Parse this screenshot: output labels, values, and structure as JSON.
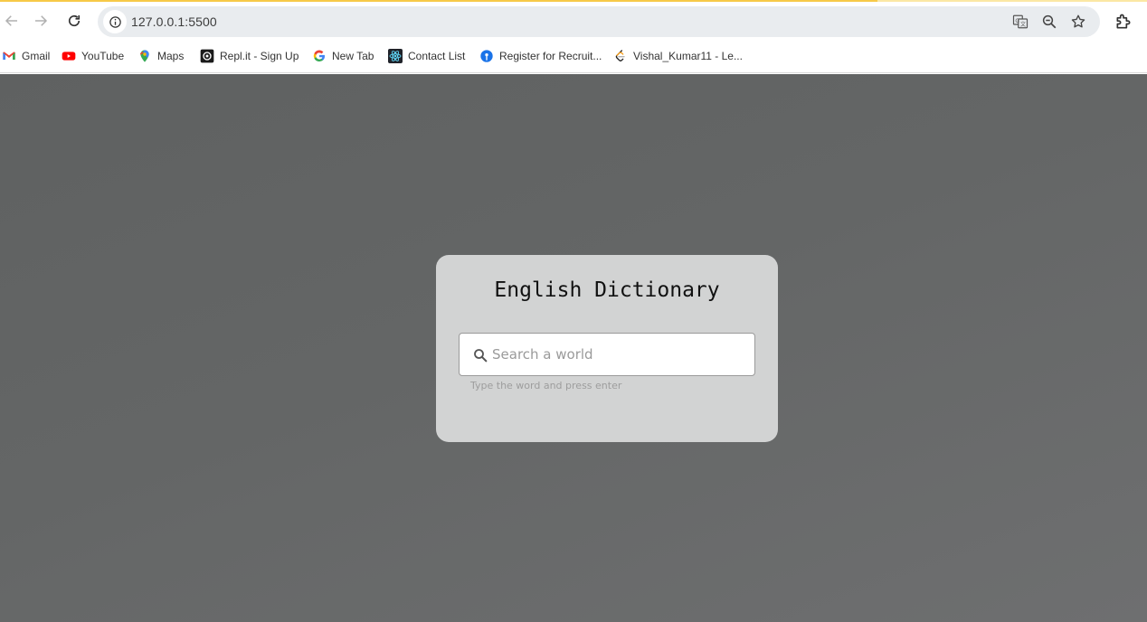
{
  "browser": {
    "url": "127.0.0.1:5500",
    "bookmarks": [
      {
        "label": "Gmail",
        "icon": "gmail-icon"
      },
      {
        "label": "YouTube",
        "icon": "youtube-icon"
      },
      {
        "label": "Maps",
        "icon": "maps-icon"
      },
      {
        "label": "Repl.it - Sign Up",
        "icon": "replit-icon"
      },
      {
        "label": "New Tab",
        "icon": "google-icon"
      },
      {
        "label": "Contact List",
        "icon": "react-icon"
      },
      {
        "label": "Register for Recruit...",
        "icon": "sbi-icon"
      },
      {
        "label": "Vishal_Kumar11 - Le...",
        "icon": "leetcode-icon"
      }
    ]
  },
  "app": {
    "title": "English Dictionary",
    "search_placeholder": "Search a world",
    "hint": "Type the word and press enter"
  },
  "colors": {
    "page_background": "#646666",
    "card_background": "#d2d3d3",
    "loading_bar": "#f7c948"
  }
}
